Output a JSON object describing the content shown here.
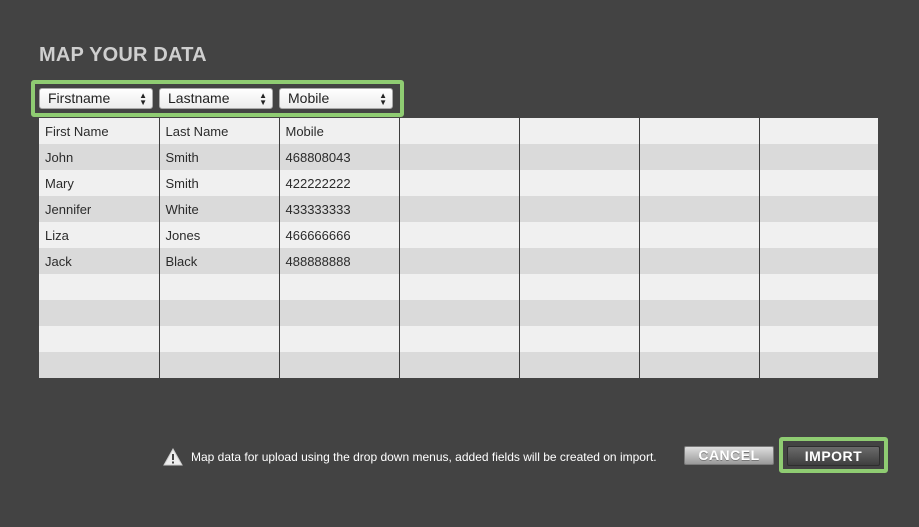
{
  "dialog": {
    "title": "MAP YOUR DATA"
  },
  "mapping": {
    "selects": [
      {
        "value": "Firstname"
      },
      {
        "value": "Lastname"
      },
      {
        "value": "Mobile"
      }
    ]
  },
  "table": {
    "rows": [
      [
        "First Name",
        "Last Name",
        "Mobile",
        "",
        "",
        "",
        ""
      ],
      [
        "John",
        "Smith",
        "468808043",
        "",
        "",
        "",
        ""
      ],
      [
        "Mary",
        "Smith",
        "422222222",
        "",
        "",
        "",
        ""
      ],
      [
        "Jennifer",
        "White",
        "433333333",
        "",
        "",
        "",
        ""
      ],
      [
        "Liza",
        "Jones",
        "466666666",
        "",
        "",
        "",
        ""
      ],
      [
        "Jack",
        "Black",
        "488888888",
        "",
        "",
        "",
        ""
      ],
      [
        "",
        "",
        "",
        "",
        "",
        "",
        ""
      ],
      [
        "",
        "",
        "",
        "",
        "",
        "",
        ""
      ],
      [
        "",
        "",
        "",
        "",
        "",
        "",
        ""
      ],
      [
        "",
        "",
        "",
        "",
        "",
        "",
        ""
      ]
    ]
  },
  "footer": {
    "note": "Map data for upload using the drop down menus, added fields will be created on import.",
    "icon": "warning-icon",
    "cancel_label": "CANCEL",
    "import_label": "IMPORT"
  },
  "colors": {
    "background": "#434343",
    "highlight": "#8fcc72",
    "row_light": "#f0f0f0",
    "row_dark": "#dadada"
  }
}
